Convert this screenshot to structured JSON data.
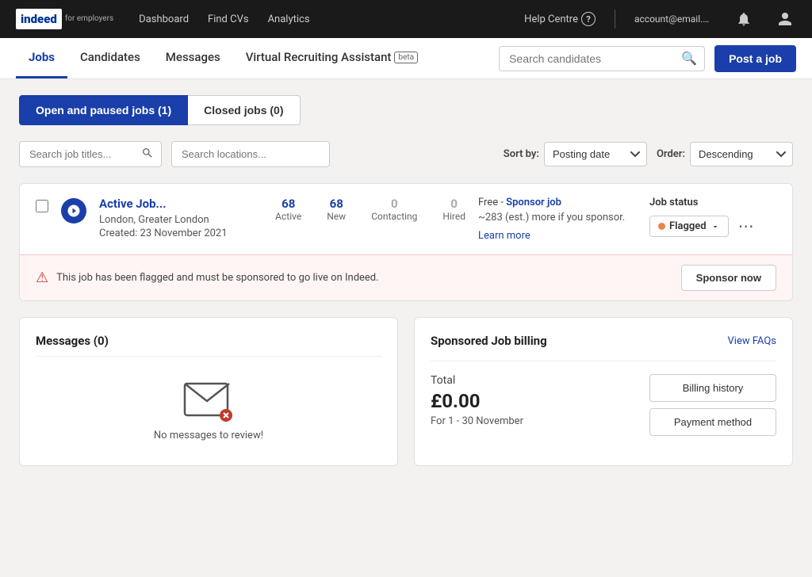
{
  "topnav": {
    "logo": "indeed",
    "logo_sub": "for employers",
    "links": [
      {
        "label": "Dashboard",
        "id": "dashboard"
      },
      {
        "label": "Find CVs",
        "id": "find-cvs"
      },
      {
        "label": "Analytics",
        "id": "analytics"
      }
    ],
    "help_centre": "Help Centre",
    "help_icon": "?",
    "notifications_icon": "bell",
    "account_icon": "person"
  },
  "subnav": {
    "tabs": [
      {
        "label": "Jobs",
        "id": "jobs",
        "active": true
      },
      {
        "label": "Candidates",
        "id": "candidates"
      },
      {
        "label": "Messages",
        "id": "messages"
      },
      {
        "label": "Virtual Recruiting Assistant",
        "id": "vra",
        "badge": "beta"
      }
    ],
    "search_placeholder": "Search candidates",
    "post_job_label": "Post a job"
  },
  "jobs_tabs": [
    {
      "label": "Open and paused jobs (1)",
      "id": "open",
      "active": true
    },
    {
      "label": "Closed jobs (0)",
      "id": "closed",
      "active": false
    }
  ],
  "filters": {
    "title_placeholder": "Search job titles...",
    "location_placeholder": "Search locations...",
    "sort_label": "Sort by:",
    "sort_value": "Posting date",
    "order_label": "Order:",
    "order_value": "Descending"
  },
  "job_card": {
    "title": "Active Job...",
    "location": "London, Greater London",
    "created": "Created: 23 November 2021",
    "stats": [
      {
        "value": "68",
        "label": "Active",
        "blue": true
      },
      {
        "value": "68",
        "label": "New",
        "blue": true
      },
      {
        "value": "0",
        "label": "Contacting",
        "blue": false
      },
      {
        "value": "0",
        "label": "Hired",
        "blue": false
      }
    ],
    "sponsor_free": "Free - ",
    "sponsor_link": "Sponsor job",
    "sponsor_est": "~283 (est.) more if you sponsor.",
    "sponsor_learn": "Learn more",
    "status_label": "Job status",
    "status_value": "Flagged",
    "flag_message": "This job has been flagged and must be sponsored to go live on Indeed.",
    "sponsor_now_label": "Sponsor now"
  },
  "messages": {
    "title": "Messages (0)",
    "empty_text": "No messages to review!"
  },
  "billing": {
    "title": "Sponsored Job billing",
    "view_faqs": "View FAQs",
    "total_label": "Total",
    "amount": "£0.00",
    "period": "For 1 - 30 November",
    "billing_history_label": "Billing history",
    "payment_method_label": "Payment method"
  }
}
